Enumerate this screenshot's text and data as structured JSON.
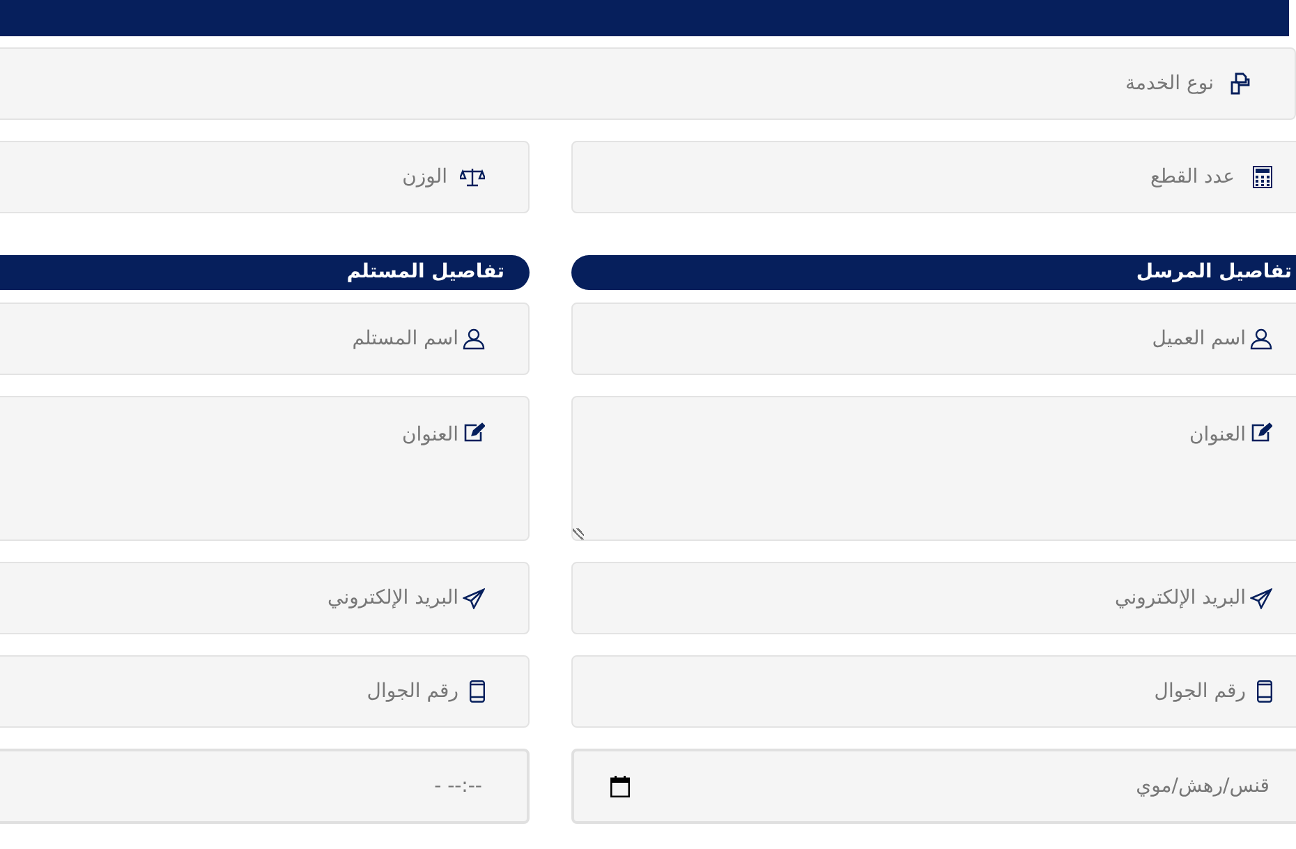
{
  "service_type": {
    "placeholder": "نوع الخدمة"
  },
  "pieces": {
    "placeholder": "عدد القطع"
  },
  "weight": {
    "placeholder": "الوزن"
  },
  "sender": {
    "title": "تفاصيل المرسل",
    "fields": [
      {
        "kind": "text",
        "placeholder": "اسم العميل"
      },
      {
        "kind": "textarea",
        "placeholder": "العنوان"
      },
      {
        "kind": "text",
        "placeholder": "البريد الإلكتروني"
      },
      {
        "kind": "text",
        "placeholder": "رقم الجوال"
      },
      {
        "kind": "date",
        "placeholder": "قنس/رهش/موي"
      }
    ]
  },
  "receiver": {
    "title": "تفاصيل المستلم",
    "fields": [
      {
        "kind": "text",
        "placeholder": "اسم المستلم"
      },
      {
        "kind": "textarea",
        "placeholder": "العنوان"
      },
      {
        "kind": "text",
        "placeholder": "البريد الإلكتروني"
      },
      {
        "kind": "text",
        "placeholder": "رقم الجوال"
      },
      {
        "kind": "time",
        "placeholder": "--:-- -"
      }
    ]
  }
}
